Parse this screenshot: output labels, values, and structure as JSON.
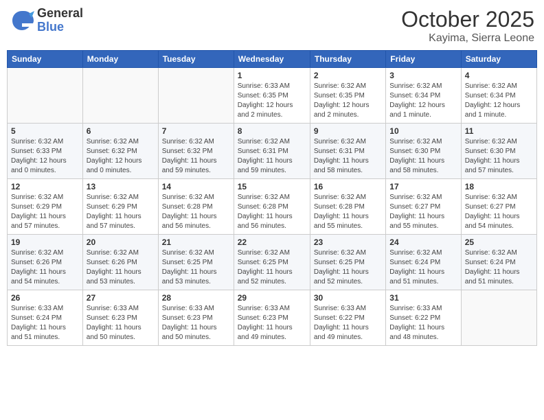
{
  "header": {
    "logo_general": "General",
    "logo_blue": "Blue",
    "month": "October 2025",
    "location": "Kayima, Sierra Leone"
  },
  "weekdays": [
    "Sunday",
    "Monday",
    "Tuesday",
    "Wednesday",
    "Thursday",
    "Friday",
    "Saturday"
  ],
  "weeks": [
    [
      {
        "day": "",
        "info": ""
      },
      {
        "day": "",
        "info": ""
      },
      {
        "day": "",
        "info": ""
      },
      {
        "day": "1",
        "info": "Sunrise: 6:33 AM\nSunset: 6:35 PM\nDaylight: 12 hours\nand 2 minutes."
      },
      {
        "day": "2",
        "info": "Sunrise: 6:32 AM\nSunset: 6:35 PM\nDaylight: 12 hours\nand 2 minutes."
      },
      {
        "day": "3",
        "info": "Sunrise: 6:32 AM\nSunset: 6:34 PM\nDaylight: 12 hours\nand 1 minute."
      },
      {
        "day": "4",
        "info": "Sunrise: 6:32 AM\nSunset: 6:34 PM\nDaylight: 12 hours\nand 1 minute."
      }
    ],
    [
      {
        "day": "5",
        "info": "Sunrise: 6:32 AM\nSunset: 6:33 PM\nDaylight: 12 hours\nand 0 minutes."
      },
      {
        "day": "6",
        "info": "Sunrise: 6:32 AM\nSunset: 6:32 PM\nDaylight: 12 hours\nand 0 minutes."
      },
      {
        "day": "7",
        "info": "Sunrise: 6:32 AM\nSunset: 6:32 PM\nDaylight: 11 hours\nand 59 minutes."
      },
      {
        "day": "8",
        "info": "Sunrise: 6:32 AM\nSunset: 6:31 PM\nDaylight: 11 hours\nand 59 minutes."
      },
      {
        "day": "9",
        "info": "Sunrise: 6:32 AM\nSunset: 6:31 PM\nDaylight: 11 hours\nand 58 minutes."
      },
      {
        "day": "10",
        "info": "Sunrise: 6:32 AM\nSunset: 6:30 PM\nDaylight: 11 hours\nand 58 minutes."
      },
      {
        "day": "11",
        "info": "Sunrise: 6:32 AM\nSunset: 6:30 PM\nDaylight: 11 hours\nand 57 minutes."
      }
    ],
    [
      {
        "day": "12",
        "info": "Sunrise: 6:32 AM\nSunset: 6:29 PM\nDaylight: 11 hours\nand 57 minutes."
      },
      {
        "day": "13",
        "info": "Sunrise: 6:32 AM\nSunset: 6:29 PM\nDaylight: 11 hours\nand 57 minutes."
      },
      {
        "day": "14",
        "info": "Sunrise: 6:32 AM\nSunset: 6:28 PM\nDaylight: 11 hours\nand 56 minutes."
      },
      {
        "day": "15",
        "info": "Sunrise: 6:32 AM\nSunset: 6:28 PM\nDaylight: 11 hours\nand 56 minutes."
      },
      {
        "day": "16",
        "info": "Sunrise: 6:32 AM\nSunset: 6:28 PM\nDaylight: 11 hours\nand 55 minutes."
      },
      {
        "day": "17",
        "info": "Sunrise: 6:32 AM\nSunset: 6:27 PM\nDaylight: 11 hours\nand 55 minutes."
      },
      {
        "day": "18",
        "info": "Sunrise: 6:32 AM\nSunset: 6:27 PM\nDaylight: 11 hours\nand 54 minutes."
      }
    ],
    [
      {
        "day": "19",
        "info": "Sunrise: 6:32 AM\nSunset: 6:26 PM\nDaylight: 11 hours\nand 54 minutes."
      },
      {
        "day": "20",
        "info": "Sunrise: 6:32 AM\nSunset: 6:26 PM\nDaylight: 11 hours\nand 53 minutes."
      },
      {
        "day": "21",
        "info": "Sunrise: 6:32 AM\nSunset: 6:25 PM\nDaylight: 11 hours\nand 53 minutes."
      },
      {
        "day": "22",
        "info": "Sunrise: 6:32 AM\nSunset: 6:25 PM\nDaylight: 11 hours\nand 52 minutes."
      },
      {
        "day": "23",
        "info": "Sunrise: 6:32 AM\nSunset: 6:25 PM\nDaylight: 11 hours\nand 52 minutes."
      },
      {
        "day": "24",
        "info": "Sunrise: 6:32 AM\nSunset: 6:24 PM\nDaylight: 11 hours\nand 51 minutes."
      },
      {
        "day": "25",
        "info": "Sunrise: 6:32 AM\nSunset: 6:24 PM\nDaylight: 11 hours\nand 51 minutes."
      }
    ],
    [
      {
        "day": "26",
        "info": "Sunrise: 6:33 AM\nSunset: 6:24 PM\nDaylight: 11 hours\nand 51 minutes."
      },
      {
        "day": "27",
        "info": "Sunrise: 6:33 AM\nSunset: 6:23 PM\nDaylight: 11 hours\nand 50 minutes."
      },
      {
        "day": "28",
        "info": "Sunrise: 6:33 AM\nSunset: 6:23 PM\nDaylight: 11 hours\nand 50 minutes."
      },
      {
        "day": "29",
        "info": "Sunrise: 6:33 AM\nSunset: 6:23 PM\nDaylight: 11 hours\nand 49 minutes."
      },
      {
        "day": "30",
        "info": "Sunrise: 6:33 AM\nSunset: 6:22 PM\nDaylight: 11 hours\nand 49 minutes."
      },
      {
        "day": "31",
        "info": "Sunrise: 6:33 AM\nSunset: 6:22 PM\nDaylight: 11 hours\nand 48 minutes."
      },
      {
        "day": "",
        "info": ""
      }
    ]
  ]
}
